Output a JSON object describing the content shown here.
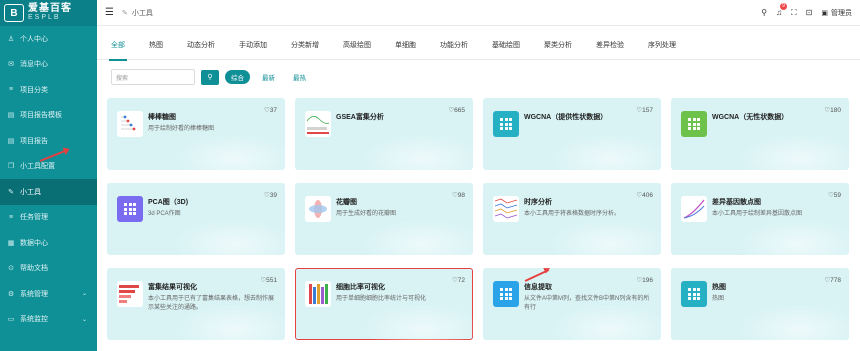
{
  "logo": {
    "mark": "B",
    "line1": "爱基百客",
    "line2": "ESPLB"
  },
  "sidebar": {
    "items": [
      {
        "label": "个人中心",
        "icon": "user-icon"
      },
      {
        "label": "消息中心",
        "icon": "message-icon"
      },
      {
        "label": "项目分类",
        "icon": "list-icon"
      },
      {
        "label": "项目报告模板",
        "icon": "document-icon"
      },
      {
        "label": "项目报告",
        "icon": "document-icon"
      },
      {
        "label": "小工具配置",
        "icon": "book-icon"
      },
      {
        "label": "小工具",
        "icon": "tool-icon",
        "active": true
      },
      {
        "label": "任务管理",
        "icon": "list-icon"
      },
      {
        "label": "数据中心",
        "icon": "database-icon"
      },
      {
        "label": "帮助文档",
        "icon": "help-icon"
      },
      {
        "label": "系统管理",
        "icon": "gear-icon",
        "caret": "⌄"
      },
      {
        "label": "系统监控",
        "icon": "monitor-icon",
        "caret": "⌄"
      }
    ]
  },
  "header": {
    "breadcrumb": "小工具",
    "notification_count": "9",
    "user": "管理员"
  },
  "tabs": [
    "全部",
    "热图",
    "动态分析",
    "手动添加",
    "分类新增",
    "高级绘图",
    "单细胞",
    "功能分析",
    "基础绘图",
    "聚类分析",
    "差异检验",
    "序列处理"
  ],
  "active_tab": "全部",
  "filters": {
    "search_placeholder": "搜索",
    "sort_options": [
      "综合",
      "最新",
      "最热"
    ],
    "active_sort": "综合"
  },
  "cards": [
    {
      "title": "棒棒糖图",
      "desc": "用于绘制好看的棒棒糖图",
      "likes": "♡37",
      "thumb": "lollipop"
    },
    {
      "title": "GSEA富集分析",
      "desc": "",
      "likes": "♡665",
      "thumb": "gsea"
    },
    {
      "title": "WGCNA（提供性状数据）",
      "desc": "",
      "likes": "♡157",
      "thumb": "teal-grid"
    },
    {
      "title": "WGCNA（无性状数据）",
      "desc": "",
      "likes": "♡180",
      "thumb": "green-grid"
    },
    {
      "title": "PCA图（3D)",
      "desc": "3d PCA作图",
      "likes": "♡39",
      "thumb": "purple-grid"
    },
    {
      "title": "花瓣图",
      "desc": "用于生成好看的花瓣图",
      "likes": "♡98",
      "thumb": "petal"
    },
    {
      "title": "时序分析",
      "desc": "本小工具用于将表格数据时序分析。",
      "likes": "♡406",
      "thumb": "timeseries"
    },
    {
      "title": "差异基因散点图",
      "desc": "本小工具用于绘制差异基因散点图",
      "likes": "♡59",
      "thumb": "scatter"
    },
    {
      "title": "富集结果可视化",
      "desc": "本小工具用于已有了富集结果表格，想去制作展示某些关注的通路。",
      "likes": "♡551",
      "thumb": "enrich"
    },
    {
      "title": "细胞比率可视化",
      "desc": "用于单细胞细胞比率统计与可视化",
      "likes": "♡72",
      "thumb": "cellratio",
      "highlight": true
    },
    {
      "title": "信息提取",
      "desc": "从文件A中第M列，查找文件B中第N列含有的所有行",
      "likes": "♡196",
      "thumb": "blue-grid"
    },
    {
      "title": "热图",
      "desc": "热图",
      "likes": "♡778",
      "thumb": "teal-grid"
    }
  ]
}
